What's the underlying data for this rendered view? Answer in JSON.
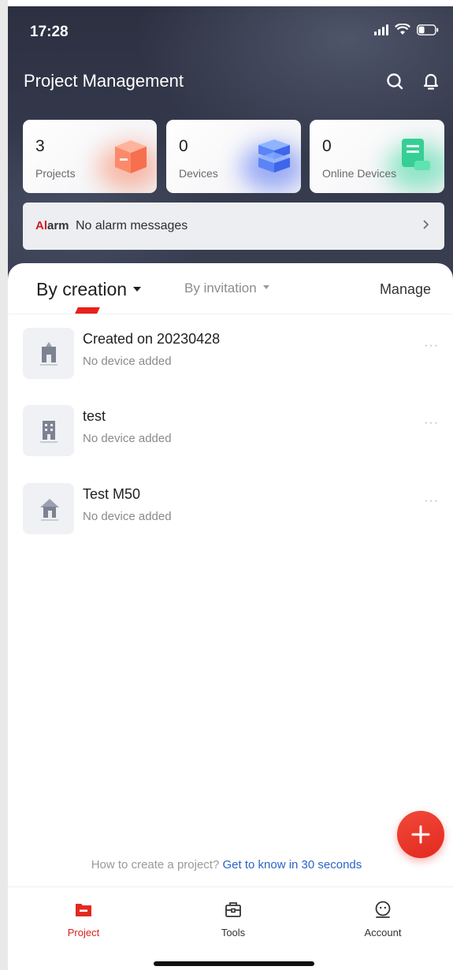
{
  "status_bar": {
    "time": "17:28"
  },
  "header": {
    "title": "Project Management"
  },
  "stats": [
    {
      "value": "3",
      "label": "Projects",
      "icon": "box-icon",
      "accent": "#f98a6a"
    },
    {
      "value": "0",
      "label": "Devices",
      "icon": "server-stack-icon",
      "accent": "#4f6ff6"
    },
    {
      "value": "0",
      "label": "Online Devices",
      "icon": "document-stack-icon",
      "accent": "#3fd9a0"
    }
  ],
  "alarm": {
    "tag_prefix": "Al",
    "tag_suffix": "arm",
    "message": "No alarm messages"
  },
  "tabs": {
    "active": "By creation",
    "inactive": "By invitation",
    "manage": "Manage"
  },
  "projects": [
    {
      "name": "Created on 20230428",
      "status": "No device added",
      "icon": "school-building-icon"
    },
    {
      "name": "test",
      "status": "No device added",
      "icon": "office-building-icon"
    },
    {
      "name": "Test M50",
      "status": "No device added",
      "icon": "house-icon"
    }
  ],
  "help": {
    "question": "How to create a project?",
    "link": "Get to know in 30 seconds"
  },
  "tabbar": [
    {
      "label": "Project"
    },
    {
      "label": "Tools"
    },
    {
      "label": "Account"
    }
  ],
  "colors": {
    "brand_red": "#e3291f",
    "link_blue": "#2b63c9",
    "header_dark": "#2c3041"
  }
}
